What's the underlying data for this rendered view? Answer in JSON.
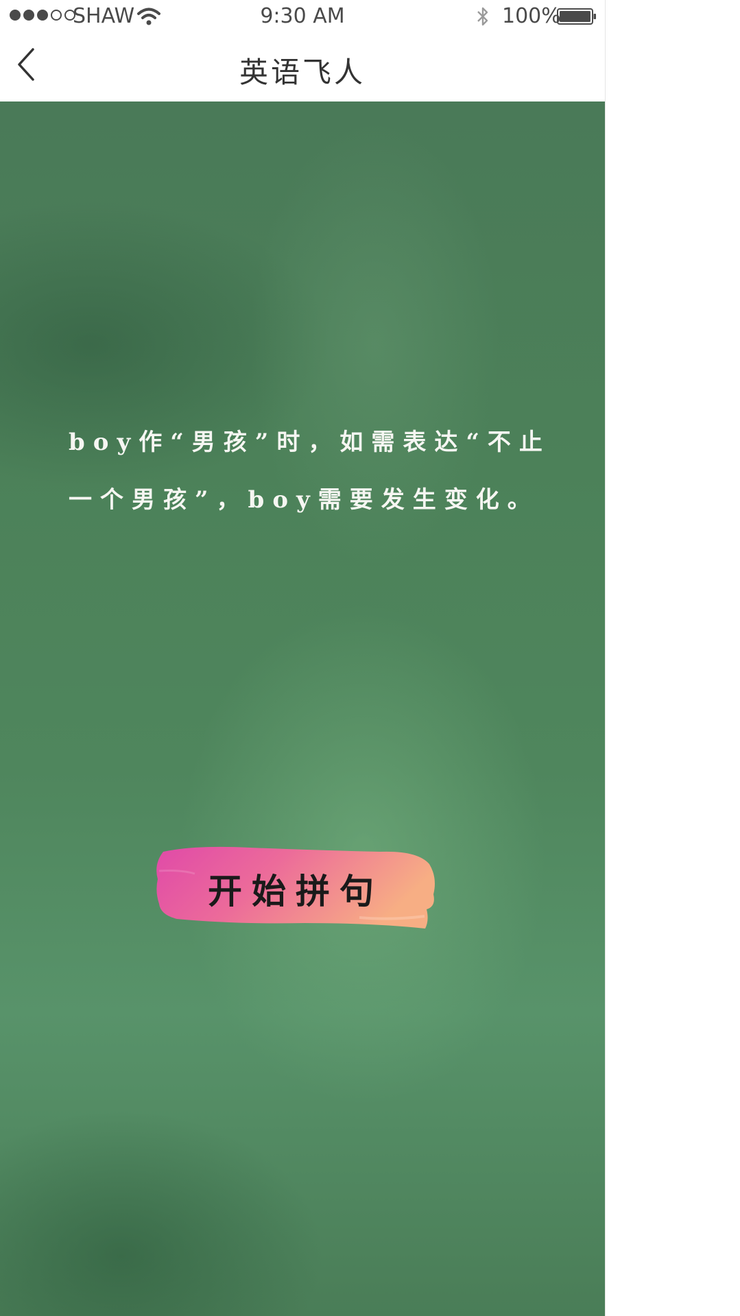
{
  "status_bar": {
    "carrier": "SHAW",
    "time": "9:30 AM",
    "battery": "100%",
    "signal_bars_filled": 3,
    "signal_bars_total": 5
  },
  "nav": {
    "title": "英语飞人",
    "back_icon": "chevron-left-icon"
  },
  "main": {
    "hint_text": "boy作“男孩”时，如需表达“不止一个男孩”，boy需要发生变化。",
    "start_button_label": "开始拼句"
  },
  "colors": {
    "chalkboard": "#4f865d",
    "button_left": "#e04aa8",
    "button_right": "#f4a07a"
  }
}
